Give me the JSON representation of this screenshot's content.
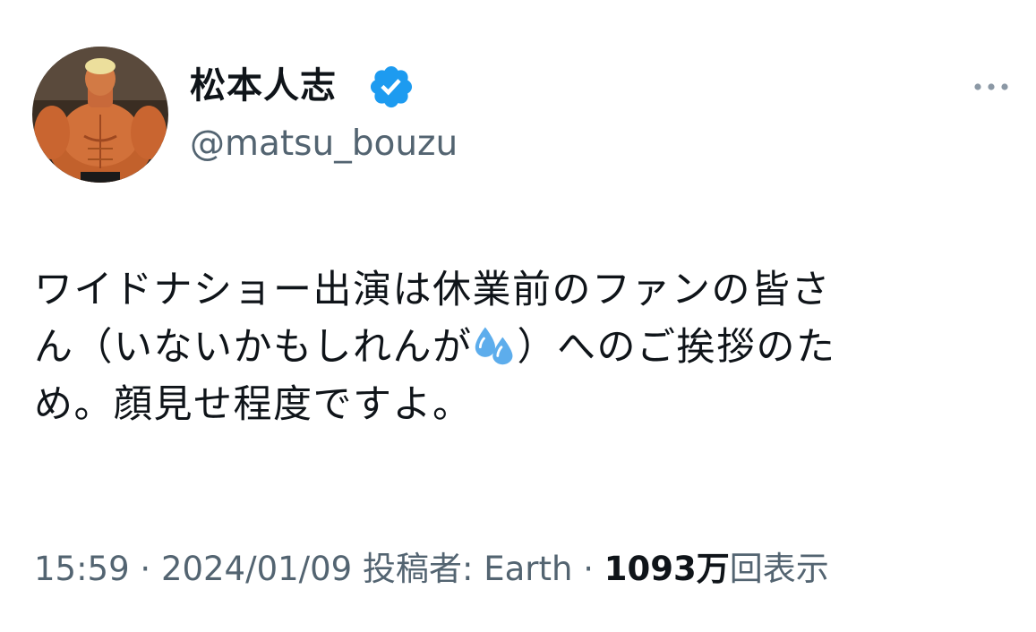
{
  "author": {
    "display_name": "松本人志",
    "handle": "@matsu_bouzu",
    "verified": true
  },
  "tweet": {
    "line1": "ワイドナショー出演は休業前のファンの皆さ",
    "line2_before": "ん（いないかもしれんが",
    "line2_emoji": "sweat-droplets-emoji",
    "line2_after": "）へのご挨拶のた",
    "line3": "め。顔見せ程度ですよ。"
  },
  "meta": {
    "time": "15:59",
    "separator": "·",
    "date": "2024/01/09",
    "source": "投稿者: Earth",
    "views_count": "1093万",
    "views_label": "回表示"
  },
  "colors": {
    "text": "#0f1419",
    "secondary": "#536471",
    "verified": "#1d9bf0"
  },
  "icons": {
    "more": "more-horizontal-icon",
    "verified": "verified-badge-icon"
  }
}
